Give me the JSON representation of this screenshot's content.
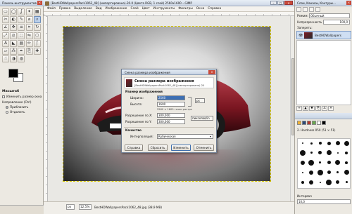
{
  "toolbox": {
    "title": "Панель инструментов",
    "close": "×",
    "tools": [
      {
        "icon": "rect-select-icon",
        "glyph": "▭"
      },
      {
        "icon": "ellipse-select-icon",
        "glyph": "◯"
      },
      {
        "icon": "lasso-icon",
        "glyph": "ʆ"
      },
      {
        "icon": "magic-wand-icon",
        "glyph": "✦"
      },
      {
        "icon": "select-by-color-icon",
        "glyph": "▦"
      },
      {
        "icon": "scissors-icon",
        "glyph": "✂"
      },
      {
        "icon": "foreground-select-icon",
        "glyph": "◐"
      },
      {
        "icon": "paths-icon",
        "glyph": "✎"
      },
      {
        "icon": "color-picker-icon",
        "glyph": "⌀"
      },
      {
        "icon": "zoom-icon",
        "glyph": "⌕"
      },
      {
        "icon": "measure-icon",
        "glyph": "∠"
      },
      {
        "icon": "move-icon",
        "glyph": "✥"
      },
      {
        "icon": "align-icon",
        "glyph": "≡"
      },
      {
        "icon": "crop-icon",
        "glyph": "⌗"
      },
      {
        "icon": "rotate-icon",
        "glyph": "↻"
      },
      {
        "icon": "scale-icon",
        "glyph": "⤢"
      },
      {
        "icon": "shear-icon",
        "glyph": "⧄"
      },
      {
        "icon": "perspective-icon",
        "glyph": "⬚"
      },
      {
        "icon": "flip-icon",
        "glyph": "⇋"
      },
      {
        "icon": "cage-icon",
        "glyph": "⬡"
      },
      {
        "icon": "text-icon",
        "glyph": "A"
      },
      {
        "icon": "bucket-fill-icon",
        "glyph": "◣"
      },
      {
        "icon": "blend-icon",
        "glyph": "▤"
      },
      {
        "icon": "pencil-icon",
        "glyph": "✏"
      },
      {
        "icon": "paintbrush-icon",
        "glyph": "ʃ"
      },
      {
        "icon": "eraser-icon",
        "glyph": "▱"
      },
      {
        "icon": "airbrush-icon",
        "glyph": "⁂"
      },
      {
        "icon": "ink-icon",
        "glyph": "✒"
      },
      {
        "icon": "clone-icon",
        "glyph": "⎘"
      },
      {
        "icon": "heal-icon",
        "glyph": "✚"
      },
      {
        "icon": "smudge-icon",
        "glyph": "☝"
      },
      {
        "icon": "dodge-burn-icon",
        "glyph": "◑"
      },
      {
        "icon": "blur-icon",
        "glyph": "◍"
      }
    ],
    "options_title": "Масштаб",
    "auto_resize": "Изменить размер окна",
    "direction_label": "Направление (Ctrl)",
    "zoom_in": "Приблизить",
    "zoom_out": "Отдалить"
  },
  "main": {
    "title": "[BestHDWallpapersPack1062_48] (импортировано)-20.0 (Цвета RGB, 1 слой) 2560x1600 – GIMP",
    "menu": [
      "Файл",
      "Правка",
      "Выделение",
      "Вид",
      "Изображение",
      "Слой",
      "Цвет",
      "Инструменты",
      "Фильтры",
      "Окна",
      "Справка"
    ],
    "minimize": "–",
    "maximize": "□",
    "close": "×",
    "unit": "px",
    "zoom": "12,5%",
    "status": "BestHDWallpapersPack1062_48.jpg (38,9 MB)"
  },
  "dialog": {
    "title": "Смена размера изображения",
    "close": "×",
    "heading": "Смена размера изображения",
    "subheading": "[BestHDWallpapersPack1062_48] (импортировано)-20",
    "section_size": "Размер изображения",
    "width_label": "Ширина:",
    "width_value": "2560",
    "height_label": "Высота:",
    "height_value": "1600",
    "dims_info": "2560 × 1600 точек растра",
    "unit": "px",
    "xres_label": "Разрешение по X:",
    "xres_value": "300,000",
    "yres_label": "Разрешение по Y:",
    "yres_value": "300,000",
    "res_unit": "пикселов/in",
    "section_quality": "Качество",
    "interp_label": "Интерполяция:",
    "interp_value": "Кубическая",
    "btn_help": "Справка",
    "btn_reset": "Сбросить",
    "btn_resize": "Изменить",
    "btn_cancel": "Отменить"
  },
  "right": {
    "title": "Слои, Каналы, Контуры…",
    "close": "×",
    "mode_label": "Режим:",
    "mode_value": "Обычный",
    "opacity_label": "Непрозрачность",
    "opacity_value": "100,0",
    "lock_label": "Запереть:",
    "layer_name": "BestHDWallpapers",
    "btn_new": "+",
    "btn_up": "▲",
    "btn_down": "▼",
    "btn_dup": "⎘",
    "btn_anchor": "⚓",
    "btn_del": "✕",
    "brush_name": "2. Hardness 050 (51 × 51)",
    "spacing_label": "Интервал",
    "spacing_value": "10,0",
    "swatch_colors": [
      "#f2b233",
      "#2d4b78",
      "#b23a2e",
      "#6aa84f",
      "#ffffff",
      "#000000"
    ]
  }
}
